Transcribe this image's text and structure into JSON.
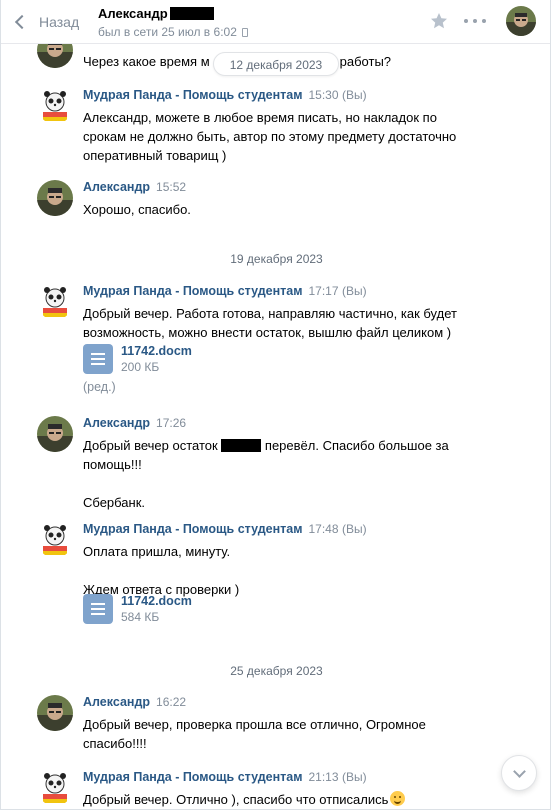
{
  "header": {
    "back_label": "Назад",
    "peer_name": "Александр",
    "peer_status": "был в сети 25 июл в 6:02"
  },
  "floating_date": "12 декабря 2023",
  "top_partial_message": "Через какое время м",
  "top_partial_tail": "работы?",
  "dates": {
    "d19": "19 декабря 2023",
    "d25": "25 декабря 2023"
  },
  "messages": [
    {
      "author": "Мудрая Панда - Помощь студентам",
      "time": "15:30",
      "you": "(Вы)",
      "text": "Александр, можете в любое время писать, но накладок по\nсрокам не должно быть, автор по этому предмету достаточно\nоперативный товарищ )"
    },
    {
      "author": "Александр",
      "time": "15:52",
      "text": "Хорошо, спасибо."
    },
    {
      "author": "Мудрая Панда - Помощь студентам",
      "time": "17:17",
      "you": "(Вы)",
      "text": "Добрый вечер. Работа готова, направляю частично, как будет\nвозможность, можно внести остаток, вышлю файл целиком )",
      "doc": {
        "name": "11742.docm",
        "size": "200 КБ"
      },
      "edited": "(ред.)"
    },
    {
      "author": "Александр",
      "time": "17:26",
      "text_before": "Добрый вечер остаток ",
      "text_after": " перевёл. Спасибо большое за",
      "text_line2": "помощь!!!",
      "text_line3": "Сбербанк."
    },
    {
      "author": "Мудрая Панда - Помощь студентам",
      "time": "17:48",
      "you": "(Вы)",
      "text": "Оплата пришла, минуту.\n\nЖдем ответа с проверки )",
      "doc": {
        "name": "11742.docm",
        "size": "584 КБ"
      }
    },
    {
      "author": "Александр",
      "time": "16:22",
      "text": "Добрый вечер, проверка прошла все отлично, Огромное\nспасибо!!!!"
    },
    {
      "author": "Мудрая Панда - Помощь студентам",
      "time": "21:13",
      "you": "(Вы)",
      "text": "Добрый вечер. Отлично ), спасибо что отписались"
    }
  ],
  "colors": {
    "link": "#2a5885",
    "muted": "#818c99",
    "doc_icon": "#7fa3cc"
  },
  "icons": [
    "chevron-left-icon",
    "star-icon",
    "more-icon",
    "document-icon",
    "chevron-down-icon",
    "smile-emoji-icon"
  ]
}
